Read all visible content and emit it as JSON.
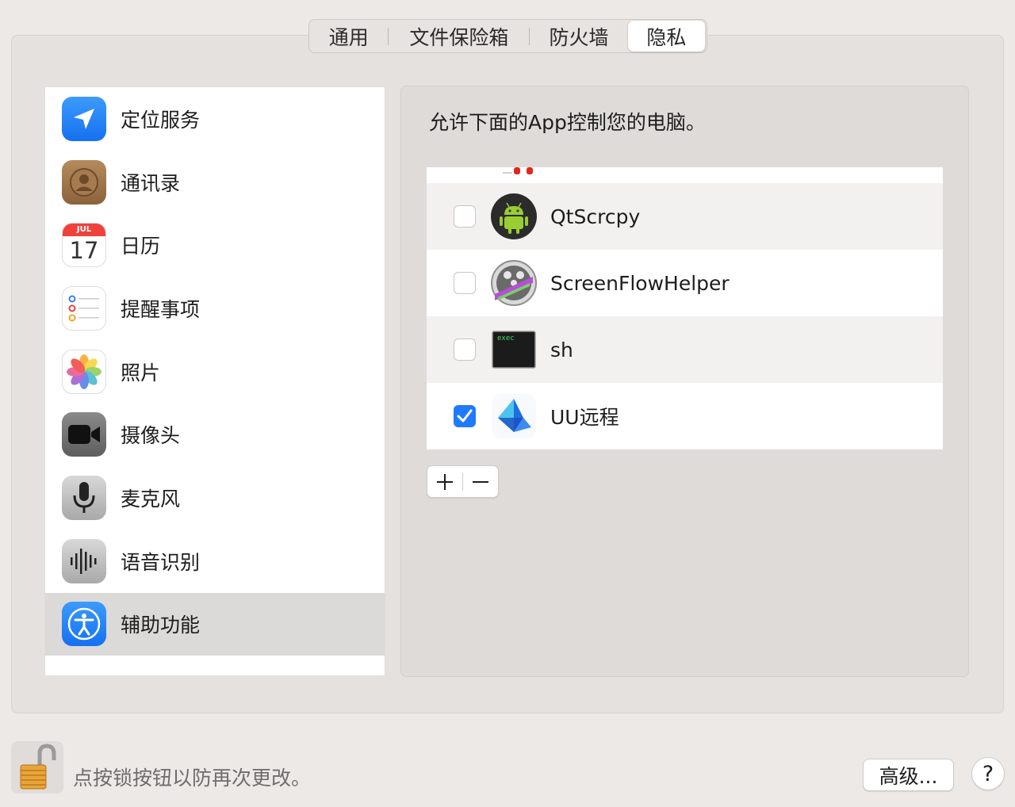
{
  "tabs": [
    {
      "label": "通用",
      "selected": false
    },
    {
      "label": "文件保险箱",
      "selected": false
    },
    {
      "label": "防火墙",
      "selected": false
    },
    {
      "label": "隐私",
      "selected": true
    }
  ],
  "sidebar": {
    "items": [
      {
        "label": "定位服务",
        "icon": "location-arrow-icon"
      },
      {
        "label": "通讯录",
        "icon": "contacts-icon"
      },
      {
        "label": "日历",
        "icon": "calendar-icon",
        "month": "JUL",
        "day": "17"
      },
      {
        "label": "提醒事项",
        "icon": "reminders-icon"
      },
      {
        "label": "照片",
        "icon": "photos-icon"
      },
      {
        "label": "摄像头",
        "icon": "camera-icon"
      },
      {
        "label": "麦克风",
        "icon": "microphone-icon"
      },
      {
        "label": "语音识别",
        "icon": "speech-recognition-icon"
      },
      {
        "label": "辅助功能",
        "icon": "accessibility-icon",
        "selected": true
      }
    ]
  },
  "main": {
    "description": "允许下面的App控制您的电脑。",
    "apps": [
      {
        "name": "QtScrcpy",
        "checked": false,
        "icon": "android-icon"
      },
      {
        "name": "ScreenFlowHelper",
        "checked": false,
        "icon": "screenflow-icon"
      },
      {
        "name": "sh",
        "checked": false,
        "icon": "terminal-exec-icon",
        "icon_text": "exec"
      },
      {
        "name": "UU远程",
        "checked": true,
        "icon": "uu-remote-icon"
      }
    ],
    "add_symbol": "+",
    "remove_symbol": "−"
  },
  "footer": {
    "lock_text": "点按锁按钮以防再次更改。",
    "advanced_label": "高级...",
    "help_label": "?"
  },
  "colors": {
    "accent": "#1f7aff",
    "background": "#ede9e7",
    "selected_row": "#dcdad8"
  }
}
